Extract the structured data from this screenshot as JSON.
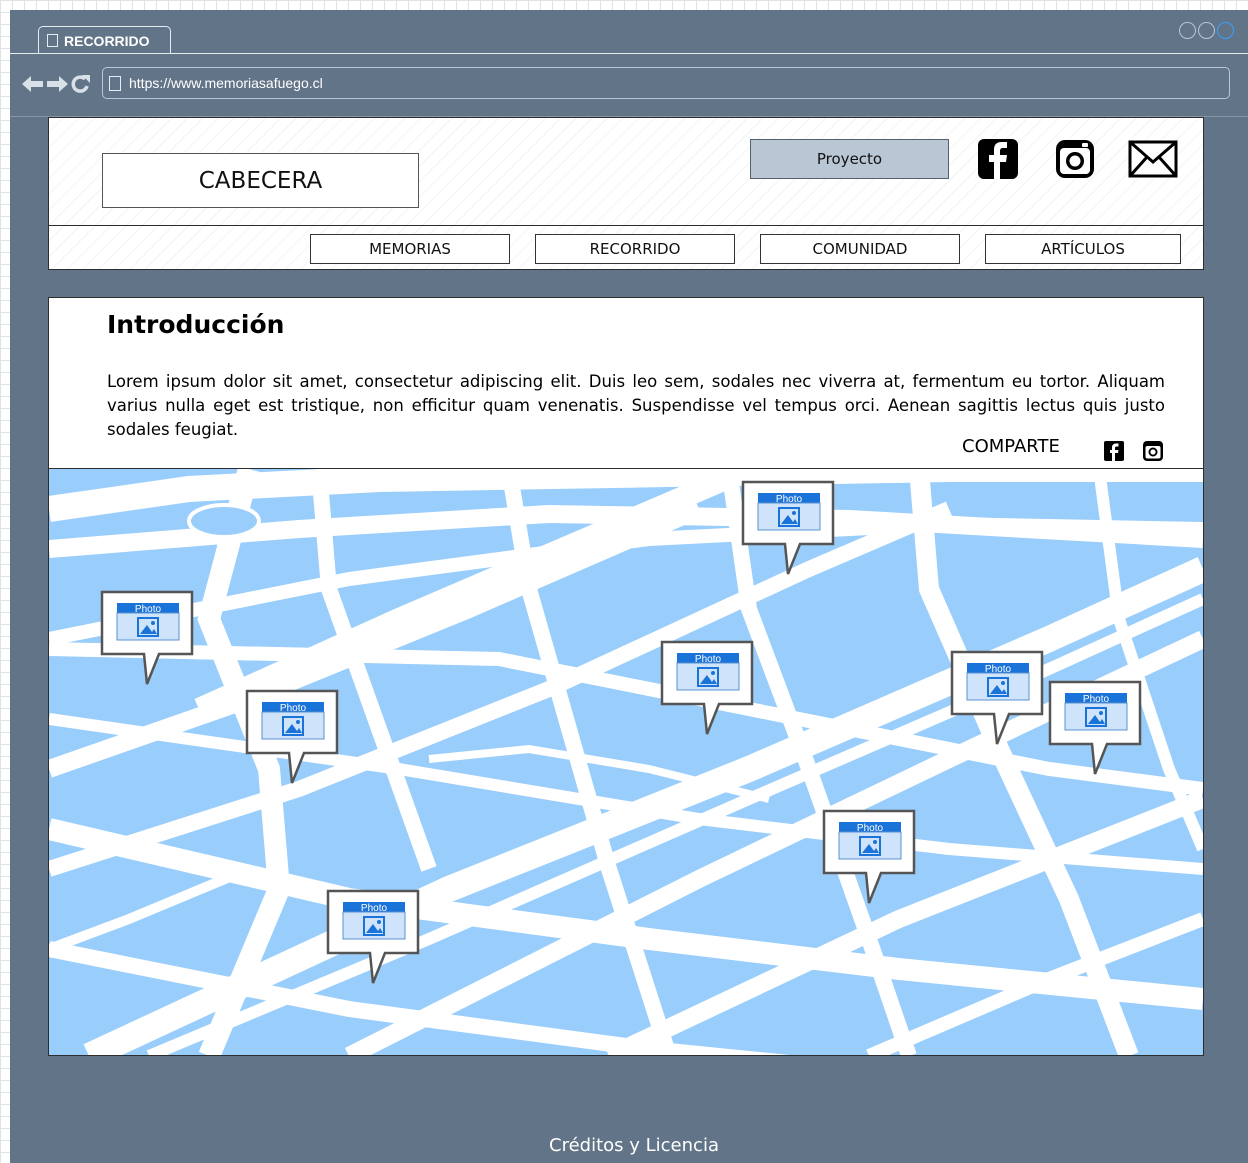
{
  "browser": {
    "tab_title": "RECORRIDO",
    "url": "https://www.memoriasafuego.cl"
  },
  "header": {
    "logo_text": "CABECERA",
    "project_button": "Proyecto",
    "social_icons": [
      "facebook-icon",
      "instagram-icon",
      "mail-icon"
    ]
  },
  "nav": {
    "items": [
      {
        "label": "MEMORIAS"
      },
      {
        "label": "RECORRIDO"
      },
      {
        "label": "COMUNIDAD"
      },
      {
        "label": "ARTÍCULOS"
      }
    ]
  },
  "intro": {
    "title": "Introducción",
    "body": "Lorem ipsum dolor sit amet, consectetur adipiscing elit. Duis leo sem, sodales nec viverra at, fermentum eu tortor. Aliquam varius nulla eget est tristique, non efficitur quam venenatis. Suspendisse vel tempus orci. Aenean sagittis lectus quis justo sodales feugiat.",
    "share_label": "COMPARTE",
    "share_icons": [
      "facebook-icon",
      "instagram-icon"
    ]
  },
  "map": {
    "marker_label": "Photo",
    "marker_icon": "image-icon",
    "marker_count": 8,
    "colors": {
      "water": "#99cdfb",
      "road": "#ffffff",
      "marker_header": "#1a73d9"
    }
  },
  "footer": {
    "text": "Créditos y Licencia"
  },
  "colors": {
    "chrome": "#627487",
    "button": "#b9c6d3"
  }
}
